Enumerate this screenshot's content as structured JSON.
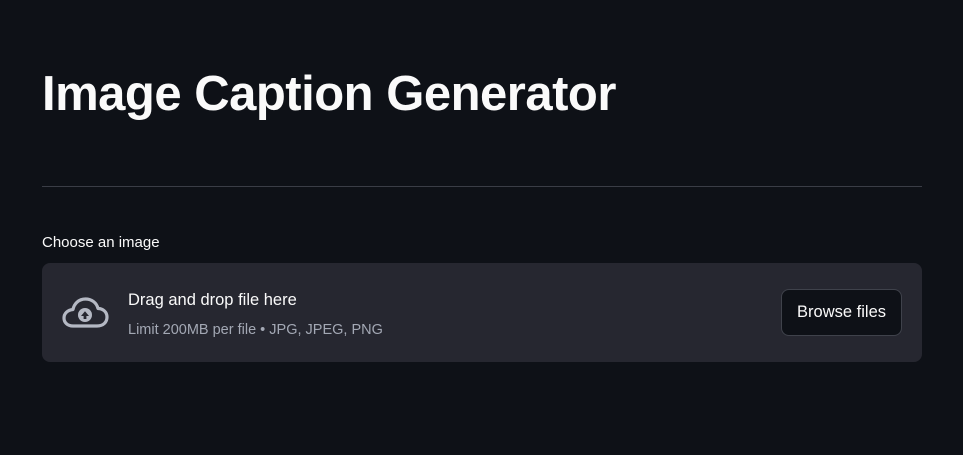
{
  "page": {
    "title": "Image Caption Generator"
  },
  "uploader": {
    "label": "Choose an image",
    "dropzone_title": "Drag and drop file here",
    "dropzone_hint": "Limit 200MB per file • JPG, JPEG, PNG",
    "browse_label": "Browse files",
    "icon": "cloud-upload-icon"
  },
  "colors": {
    "background": "#0e1117",
    "dropzone_background": "#262730",
    "text": "#fafafa",
    "muted_text": "#a3a8b4"
  }
}
